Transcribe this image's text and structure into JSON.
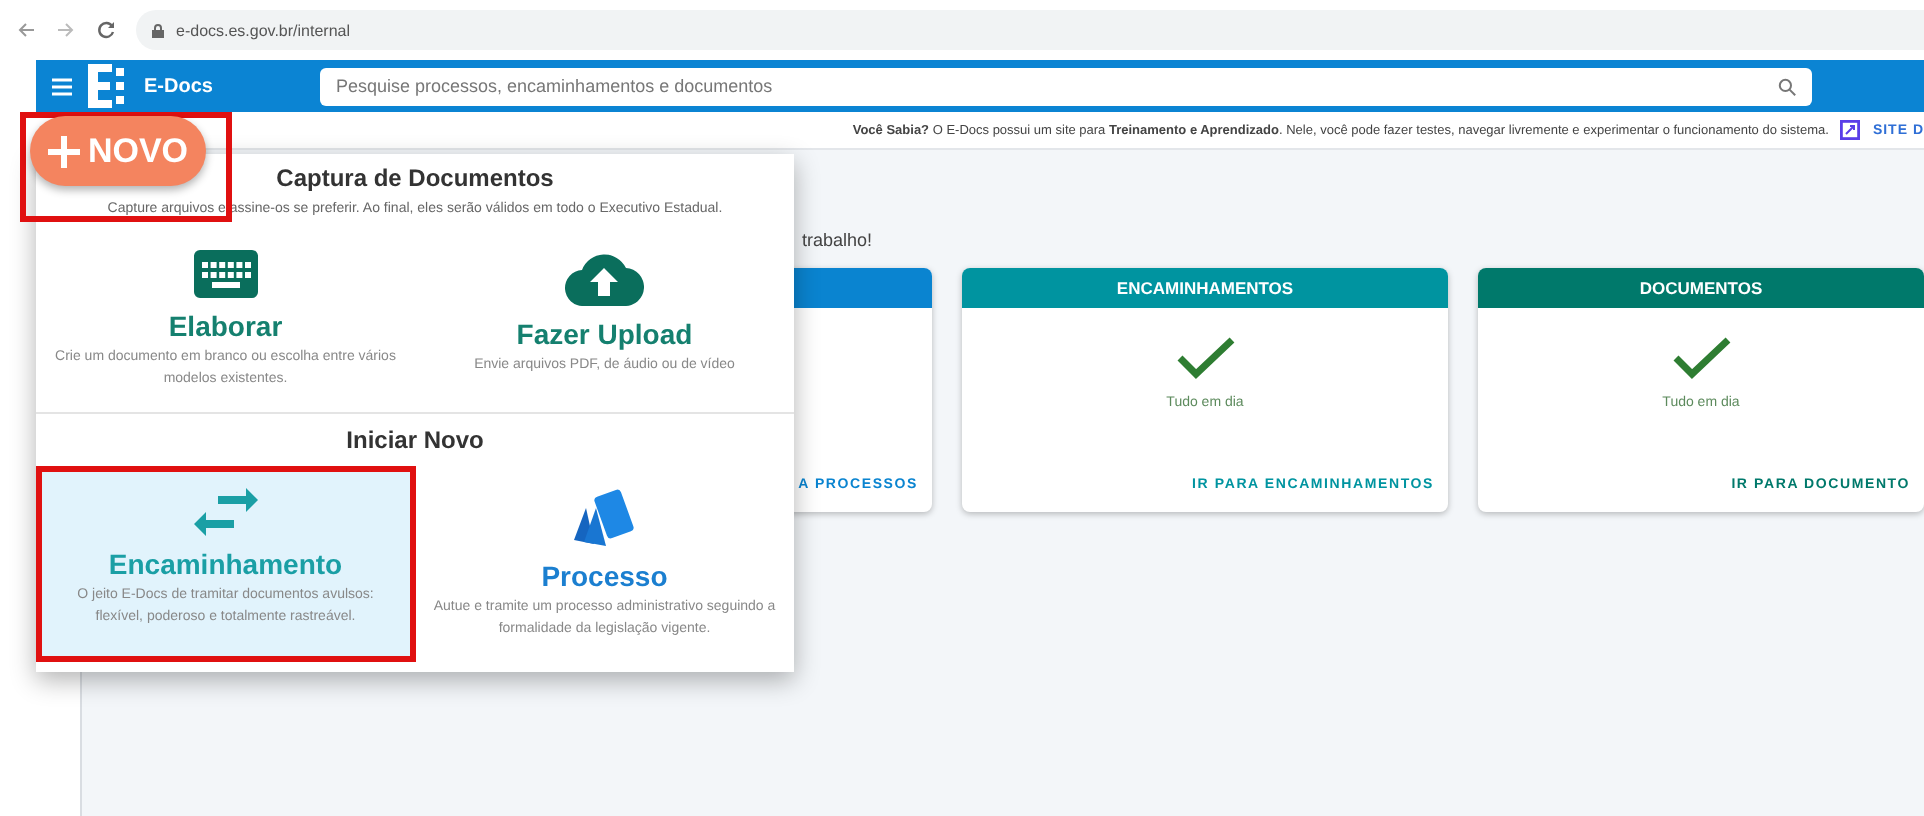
{
  "browser": {
    "url": "e-docs.es.gov.br/internal"
  },
  "header": {
    "app_name": "E-Docs",
    "search": {
      "placeholder": "Pesquise processos, encaminhamentos e documentos"
    }
  },
  "info_bar": {
    "text": "**Você Sabia?** O E-Docs possui um site para **Treinamento e Aprendizado**. Nele, você pode fazer testes, navegar livremente e experimentar o funcionamento do sistema.",
    "link": "SITE D"
  },
  "novo_button": {
    "label": "NOVO",
    "highlighted": true
  },
  "greeting_tail": "trabalho!",
  "cards": [
    {
      "link": "A PROCESSOS",
      "color": "#0a84d0"
    },
    {
      "title": "ENCAMINHAMENTOS",
      "status": "Tudo em dia",
      "link": "IR PARA ENCAMINHAMENTOS",
      "color": "#0094a0"
    },
    {
      "title": "DOCUMENTOS",
      "status": "Tudo em dia",
      "link": "IR PARA DOCUMENTO",
      "color": "#00796b"
    }
  ],
  "menu": {
    "sections": [
      {
        "title": "Captura de Documentos",
        "subtitle": "Capture arquivos e assine-os se preferir. Ao final, eles serão válidos em todo o Executivo Estadual.",
        "options": [
          {
            "title": "Elaborar",
            "description": "Crie um documento em branco ou escolha entre vários modelos existentes.",
            "color": "#15806f",
            "selected": false,
            "highlighted": false
          },
          {
            "title": "Fazer Upload",
            "description": "Envie arquivos PDF, de áudio ou de vídeo",
            "color": "#15806f",
            "selected": false,
            "highlighted": false
          }
        ]
      },
      {
        "title": "Iniciar Novo",
        "options": [
          {
            "title": "Encaminhamento",
            "description": "O jeito E-Docs de tramitar documentos avulsos: flexível, poderoso e totalmente rastreável.",
            "color": "#1a9fa5",
            "selected": true,
            "highlighted": true
          },
          {
            "title": "Processo",
            "description": "Autue e tramite um processo administrativo seguindo a formalidade da legislação vigente.",
            "color": "#1b7fd0",
            "selected": false,
            "highlighted": false
          }
        ]
      }
    ]
  }
}
